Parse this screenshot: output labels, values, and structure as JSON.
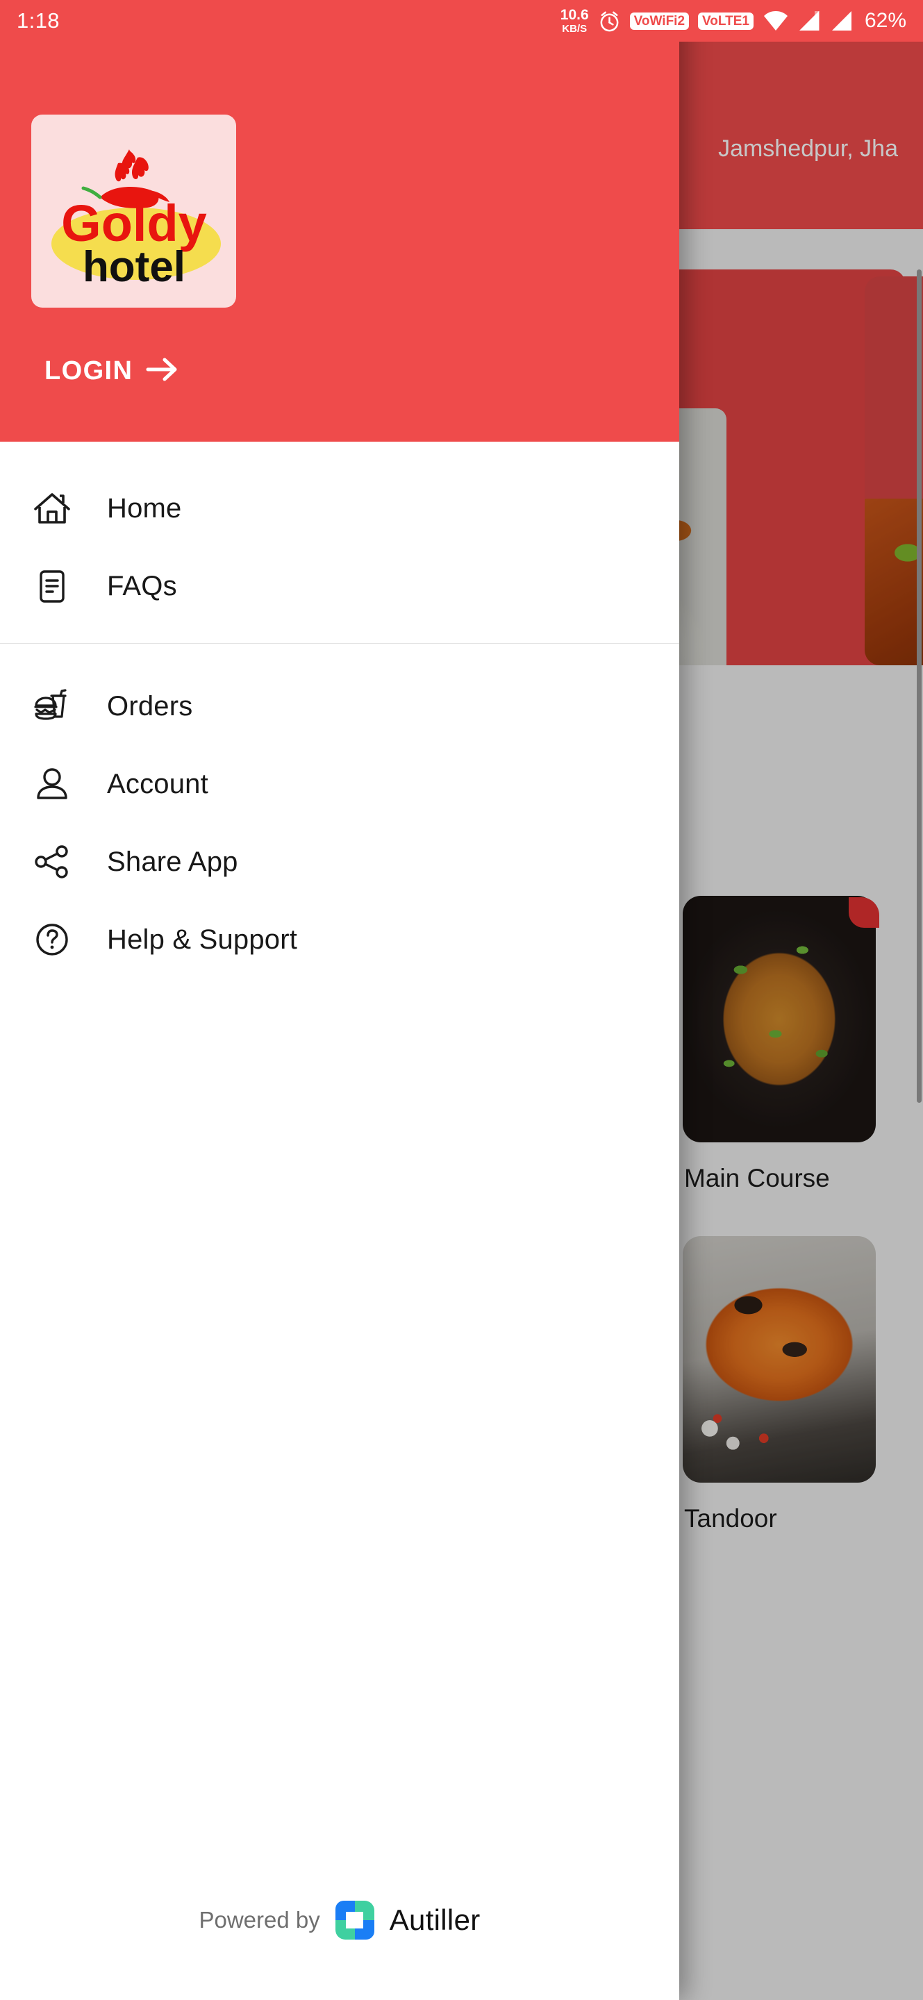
{
  "status_bar": {
    "time": "1:18",
    "net_speed_value": "10.6",
    "net_speed_unit": "KB/S",
    "alarm_icon": "alarm-clock-icon",
    "volte_wifi_badge": "VoWiFi2",
    "volte_badge": "VoLTE1",
    "wifi_icon": "wifi-icon",
    "signal_one_icon": "signal-bars-icon",
    "signal_two_icon": "signal-bars-icon",
    "battery_percent": "62%"
  },
  "drawer": {
    "brand": {
      "logo_name": "goldy-hotel-logo",
      "word_top": "Goldy",
      "word_bottom": "hotel"
    },
    "login": {
      "label": "LOGIN",
      "arrow_icon": "arrow-right-icon"
    },
    "menu_primary": [
      {
        "id": "home",
        "label": "Home",
        "icon": "home-icon"
      },
      {
        "id": "faqs",
        "label": "FAQs",
        "icon": "document-lines-icon"
      }
    ],
    "menu_secondary": [
      {
        "id": "orders",
        "label": "Orders",
        "icon": "burger-drink-icon"
      },
      {
        "id": "account",
        "label": "Account",
        "icon": "person-icon"
      },
      {
        "id": "share",
        "label": "Share App",
        "icon": "share-nodes-icon"
      },
      {
        "id": "help",
        "label": "Help & Support",
        "icon": "question-circle-icon"
      }
    ],
    "footer": {
      "powered_by": "Powered by",
      "partner_name": "Autiller",
      "partner_logo_icon": "autiller-logo-icon"
    }
  },
  "background": {
    "appbar_location": "Jamshedpur, Jha",
    "banner_logo_name": "goldy-hotel-logo-small",
    "categories": [
      {
        "id": "main-course",
        "label": "Main Course"
      },
      {
        "id": "tandoor",
        "label": "Tandoor"
      }
    ]
  },
  "colors": {
    "brand_red": "#ef4b4b",
    "brand_red_dim": "#d84444",
    "logo_yellow": "#f5dd4e",
    "logo_red": "#e8150f",
    "text_dark": "#181818",
    "footer_gray": "#6f6f6f",
    "autiller_blue": "#1a7ef5",
    "autiller_green": "#3fd0a0"
  }
}
